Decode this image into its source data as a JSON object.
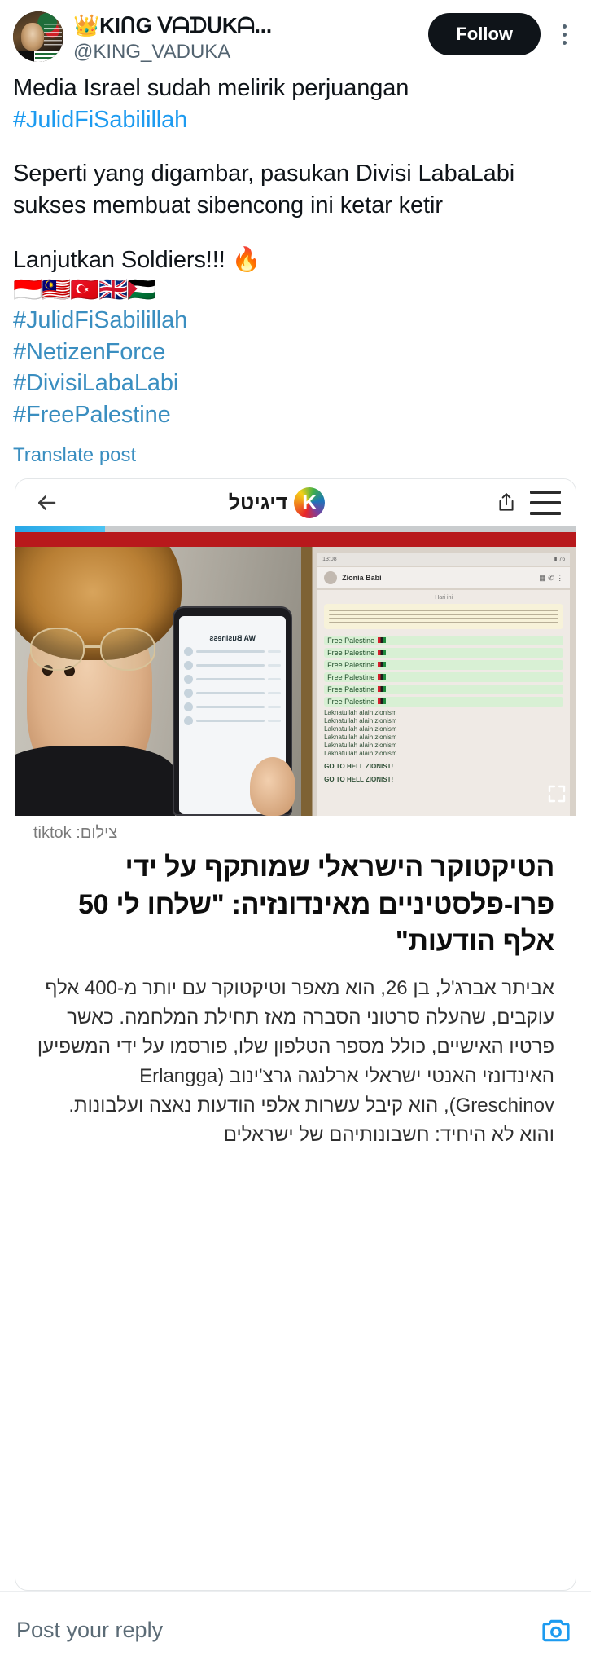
{
  "post": {
    "display_name": "👑KIᑎG ᐯᗩᗪᑌKᗩ...",
    "handle": "@KING_VADUKA",
    "follow_label": "Follow",
    "more_icon": "more-options-icon",
    "body": {
      "line1_plain": "Media Israel sudah melirik perjuangan ",
      "line1_tag": "#JulidFiSabilillah",
      "para2": "Seperti yang digambar, pasukan Divisi LabaLabi sukses membuat sibencong ini ketar ketir",
      "para3": "Lanjutkan Soldiers!!! 🔥",
      "flags": "🇮🇩🇲🇾🇹🇷🇬🇧🇵🇸",
      "hashtags": [
        "#JulidFiSabilillah",
        "#NetizenForce",
        "#DivisiLabaLabi",
        "#FreePalestine"
      ]
    },
    "translate_label": "Translate post"
  },
  "card": {
    "back_icon": "back-arrow-icon",
    "brand_text": "דיגיטל",
    "brand_logo": "keshet-k-logo-icon",
    "share_icon": "share-icon",
    "menu_icon": "hamburger-menu-icon",
    "progress_percent": 16,
    "photo": {
      "phone_app_title": "WA Business",
      "chat_name": "Zionia Babi",
      "day_label": "Hari ini",
      "free_palestine_lines": [
        "Free Palestine",
        "Free Palestine",
        "Free Palestine",
        "Free Palestine",
        "Free Palestine",
        "Free Palestine"
      ],
      "laknat_lines": [
        "Laknatullah alaih zionism",
        "Laknatullah alaih zionism",
        "Laknatullah alaih zionism",
        "Laknatullah alaih zionism",
        "Laknatullah alaih zionism",
        "Laknatullah alaih zionism"
      ],
      "hell_lines": [
        "GO TO HELL ZIONIST!",
        "GO TO HELL ZIONIST!"
      ],
      "expand_icon": "expand-fullscreen-icon"
    },
    "credit": "צילום: tiktok",
    "headline": "הטיקטוקר הישראלי שמותקף על ידי פרו-פלסטיניים מאינדונזיה: \"שלחו לי 50 אלף הודעות\"",
    "article": "אביתר אברג'ל, בן 26, הוא מאפר וטיקטוקר עם יותר מ-400 אלף עוקבים, שהעלה סרטוני הסברה מאז תחילת המלחמה. כאשר פרטיו האישיים, כולל מספר הטלפון שלו, פורסמו על ידי המשפיען האינדונזי האנטי ישראלי ארלנגה גרצ'ינוב (Erlangga Greschinov), הוא קיבל עשרות אלפי הודעות נאצה ועלבונות. והוא לא היחיד: חשבונותיהם של ישראלים"
  },
  "reply": {
    "placeholder": "Post your reply",
    "camera_icon": "camera-icon"
  },
  "colors": {
    "link": "#1d9bf0",
    "hashtag": "#3a8ec0",
    "follow_bg": "#0f1419",
    "red_bar": "#b8191c",
    "progress": "#27a7e7"
  }
}
